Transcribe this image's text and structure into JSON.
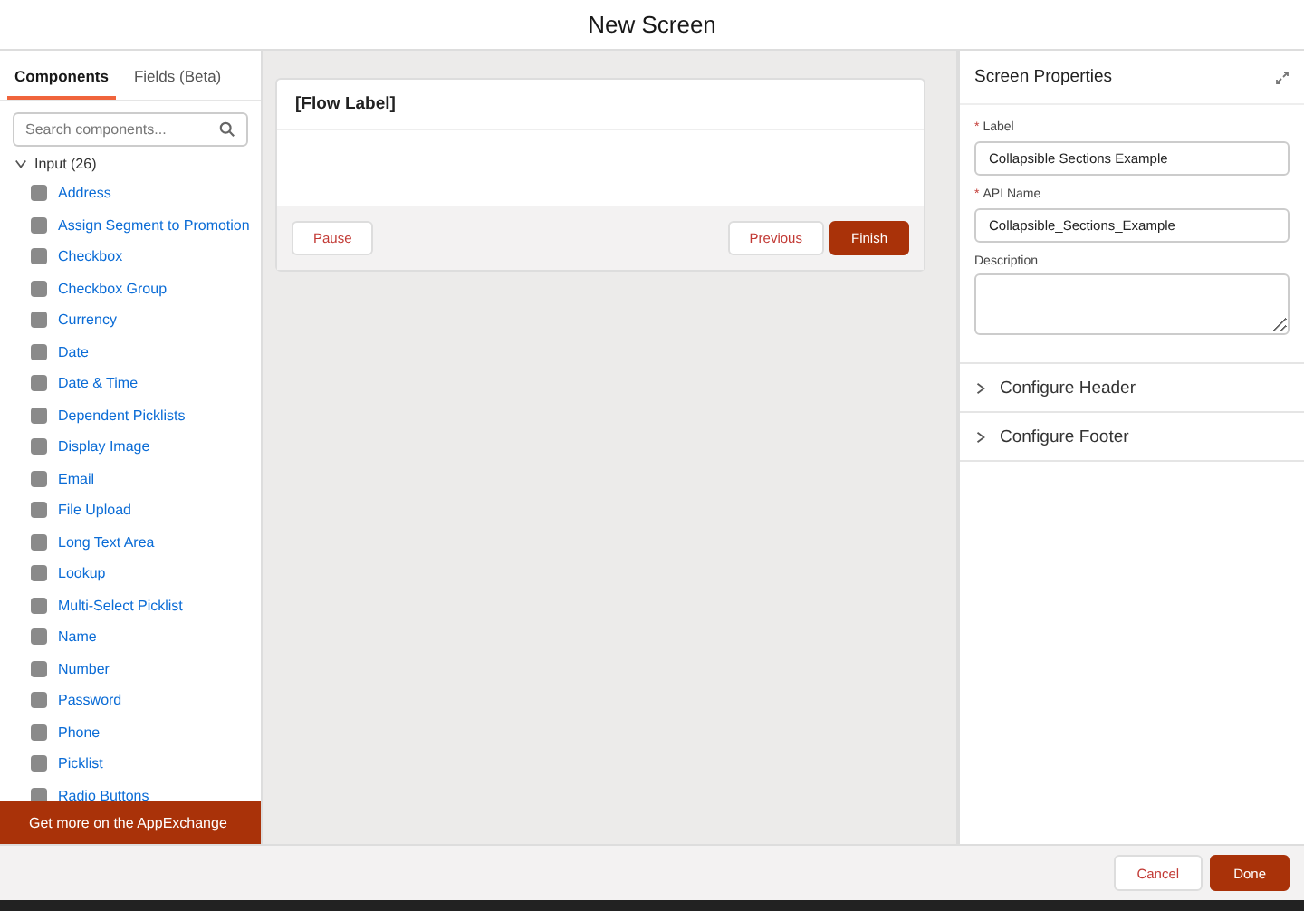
{
  "window": {
    "title": "New Screen"
  },
  "tabs": [
    {
      "label": "Components",
      "selected": true
    },
    {
      "label": "Fields (Beta)",
      "selected": false
    }
  ],
  "search": {
    "placeholder": "Search components..."
  },
  "group": {
    "label": "Input (26)",
    "expanded": true,
    "items": [
      "Address",
      "Assign Segment to Promotion",
      "Checkbox",
      "Checkbox Group",
      "Currency",
      "Date",
      "Date & Time",
      "Dependent Picklists",
      "Display Image",
      "Email",
      "File Upload",
      "Long Text Area",
      "Lookup",
      "Multi-Select Picklist",
      "Name",
      "Number",
      "Password",
      "Phone",
      "Picklist",
      "Radio Buttons"
    ]
  },
  "appexchange_button": "Get more on the AppExchange",
  "canvas": {
    "flow_label": "[Flow Label]",
    "buttons": [
      {
        "label": "Pause",
        "kind": "neutral"
      },
      {
        "label": "Previous",
        "kind": "neutral"
      },
      {
        "label": "Finish",
        "kind": "brand"
      }
    ]
  },
  "properties": {
    "title": "Screen Properties",
    "fields": [
      {
        "label": "Label",
        "required_mark": "*",
        "value": "Collapsible Sections Example",
        "kind": "input"
      },
      {
        "label": "API Name",
        "required_mark": "*",
        "value": "Collapsible_Sections_Example",
        "kind": "input"
      },
      {
        "label": "Description",
        "kind": "textarea"
      }
    ],
    "sections": [
      {
        "label": "Configure Header",
        "expanded": false
      },
      {
        "label": "Configure Footer",
        "expanded": false
      }
    ]
  },
  "footer": {
    "buttons": [
      {
        "label": "Cancel",
        "kind": "neutral"
      },
      {
        "label": "Done",
        "kind": "brand"
      }
    ]
  }
}
